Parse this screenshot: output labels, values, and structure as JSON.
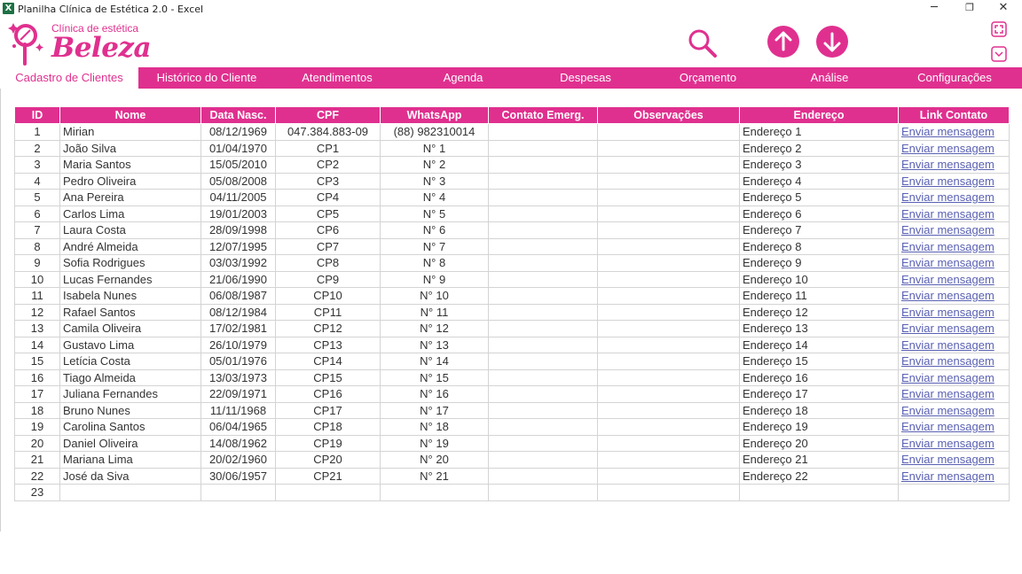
{
  "window": {
    "title": "Planilha Clínica de Estética 2.0 - Excel",
    "minimize": "─",
    "restore": "❐",
    "close": "✕"
  },
  "brand": {
    "subtitle": "Clínica de estética",
    "name": "Beleza"
  },
  "colors": {
    "accent": "#e0308f",
    "link": "#5a61b3"
  },
  "toolbar": {
    "search_icon": "search-icon",
    "up_icon": "arrow-up-icon",
    "down_icon": "arrow-down-icon",
    "expand_icon": "expand-icon",
    "collapse_icon": "chevron-down-icon"
  },
  "menu": [
    {
      "label": "Cadastro de Clientes",
      "active": true
    },
    {
      "label": "Histórico do Cliente"
    },
    {
      "label": "Atendimentos"
    },
    {
      "label": "Agenda"
    },
    {
      "label": "Despesas"
    },
    {
      "label": "Orçamento"
    },
    {
      "label": "Análise"
    },
    {
      "label": "Configurações"
    }
  ],
  "table": {
    "headers": [
      "ID",
      "Nome",
      "Data Nasc.",
      "CPF",
      "WhatsApp",
      "Contato Emerg.",
      "Observações",
      "Endereço",
      "Link Contato"
    ],
    "rows": [
      [
        "1",
        "Mirian",
        "08/12/1969",
        "047.384.883-09",
        "(88)  982310014",
        "",
        "",
        "Endereço 1",
        "Enviar mensagem"
      ],
      [
        "2",
        "João Silva",
        "01/04/1970",
        "CP1",
        "N° 1",
        "",
        "",
        "Endereço 2",
        "Enviar mensagem"
      ],
      [
        "3",
        "Maria Santos",
        "15/05/2010",
        "CP2",
        "N° 2",
        "",
        "",
        "Endereço 3",
        "Enviar mensagem"
      ],
      [
        "4",
        "Pedro Oliveira",
        "05/08/2008",
        "CP3",
        "N° 3",
        "",
        "",
        "Endereço 4",
        "Enviar mensagem"
      ],
      [
        "5",
        "Ana Pereira",
        "04/11/2005",
        "CP4",
        "N° 4",
        "",
        "",
        "Endereço 5",
        "Enviar mensagem"
      ],
      [
        "6",
        "Carlos Lima",
        "19/01/2003",
        "CP5",
        "N° 5",
        "",
        "",
        "Endereço 6",
        "Enviar mensagem"
      ],
      [
        "7",
        "Laura Costa",
        "28/09/1998",
        "CP6",
        "N° 6",
        "",
        "",
        "Endereço 7",
        "Enviar mensagem"
      ],
      [
        "8",
        "André Almeida",
        "12/07/1995",
        "CP7",
        "N° 7",
        "",
        "",
        "Endereço 8",
        "Enviar mensagem"
      ],
      [
        "9",
        "Sofia Rodrigues",
        "03/03/1992",
        "CP8",
        "N° 8",
        "",
        "",
        "Endereço 9",
        "Enviar mensagem"
      ],
      [
        "10",
        "Lucas Fernandes",
        "21/06/1990",
        "CP9",
        "N° 9",
        "",
        "",
        "Endereço 10",
        "Enviar mensagem"
      ],
      [
        "11",
        "Isabela Nunes",
        "06/08/1987",
        "CP10",
        "N° 10",
        "",
        "",
        "Endereço 11",
        "Enviar mensagem"
      ],
      [
        "12",
        "Rafael Santos",
        "08/12/1984",
        "CP11",
        "N° 11",
        "",
        "",
        "Endereço 12",
        "Enviar mensagem"
      ],
      [
        "13",
        "Camila Oliveira",
        "17/02/1981",
        "CP12",
        "N° 12",
        "",
        "",
        "Endereço 13",
        "Enviar mensagem"
      ],
      [
        "14",
        "Gustavo Lima",
        "26/10/1979",
        "CP13",
        "N° 13",
        "",
        "",
        "Endereço 14",
        "Enviar mensagem"
      ],
      [
        "15",
        "Letícia Costa",
        "05/01/1976",
        "CP14",
        "N° 14",
        "",
        "",
        "Endereço 15",
        "Enviar mensagem"
      ],
      [
        "16",
        "Tiago Almeida",
        "13/03/1973",
        "CP15",
        "N° 15",
        "",
        "",
        "Endereço 16",
        "Enviar mensagem"
      ],
      [
        "17",
        "Juliana Fernandes",
        "22/09/1971",
        "CP16",
        "N° 16",
        "",
        "",
        "Endereço 17",
        "Enviar mensagem"
      ],
      [
        "18",
        "Bruno Nunes",
        "11/11/1968",
        "CP17",
        "N° 17",
        "",
        "",
        "Endereço 18",
        "Enviar mensagem"
      ],
      [
        "19",
        "Carolina Santos",
        "06/04/1965",
        "CP18",
        "N° 18",
        "",
        "",
        "Endereço 19",
        "Enviar mensagem"
      ],
      [
        "20",
        "Daniel Oliveira",
        "14/08/1962",
        "CP19",
        "N° 19",
        "",
        "",
        "Endereço 20",
        "Enviar mensagem"
      ],
      [
        "21",
        "Mariana Lima",
        "20/02/1960",
        "CP20",
        "N° 20",
        "",
        "",
        "Endereço 21",
        "Enviar mensagem"
      ],
      [
        "22",
        "José da Siva",
        "30/06/1957",
        "CP21",
        "N° 21",
        "",
        "",
        "Endereço 22",
        "Enviar mensagem"
      ],
      [
        "23",
        "",
        "",
        "",
        "",
        "",
        "",
        "",
        ""
      ]
    ]
  }
}
